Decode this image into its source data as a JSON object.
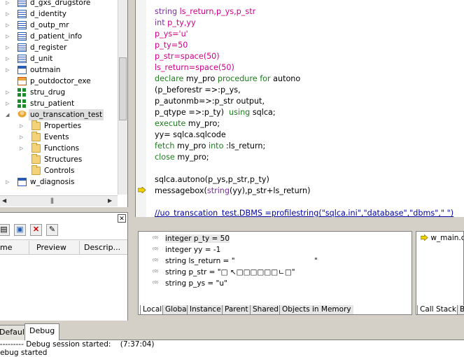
{
  "tree": {
    "items": [
      {
        "label": "d_gxs_drugstore",
        "icon": "datawindow-icon",
        "depth": 1,
        "expander": "closed"
      },
      {
        "label": "d_identity",
        "icon": "datawindow-icon",
        "depth": 1,
        "expander": "closed"
      },
      {
        "label": "d_outp_mr",
        "icon": "datawindow-icon",
        "depth": 1,
        "expander": "closed"
      },
      {
        "label": "d_patient_info",
        "icon": "datawindow-icon",
        "depth": 1,
        "expander": "closed"
      },
      {
        "label": "d_register",
        "icon": "datawindow-icon",
        "depth": 1,
        "expander": "closed"
      },
      {
        "label": "d_unit",
        "icon": "datawindow-icon",
        "depth": 1,
        "expander": "closed"
      },
      {
        "label": "outmain",
        "icon": "window-icon",
        "depth": 1,
        "expander": "closed"
      },
      {
        "label": "p_outdoctor_exe",
        "icon": "exe-icon",
        "depth": 1,
        "expander": "none"
      },
      {
        "label": "stru_drug",
        "icon": "structure-icon",
        "depth": 1,
        "expander": "closed"
      },
      {
        "label": "stru_patient",
        "icon": "structure-icon",
        "depth": 1,
        "expander": "closed"
      },
      {
        "label": "uo_transcation_test",
        "icon": "user-object-icon",
        "depth": 1,
        "expander": "open",
        "selected": true
      },
      {
        "label": "Properties",
        "icon": "folder-icon",
        "depth": 2,
        "expander": "closed"
      },
      {
        "label": "Events",
        "icon": "folder-icon",
        "depth": 2,
        "expander": "closed"
      },
      {
        "label": "Functions",
        "icon": "folder-icon",
        "depth": 2,
        "expander": "closed"
      },
      {
        "label": "Structures",
        "icon": "folder-icon",
        "depth": 2,
        "expander": "none"
      },
      {
        "label": "Controls",
        "icon": "folder-icon",
        "depth": 2,
        "expander": "none"
      },
      {
        "label": "w_diagnosis",
        "icon": "window-icon",
        "depth": 1,
        "expander": "closed"
      }
    ]
  },
  "lower_left": {
    "close_glyph": "✕",
    "columns": [
      "me",
      "Preview",
      "Descrip..."
    ]
  },
  "code": {
    "lines": [
      [
        {
          "t": "string",
          "c": "ty"
        },
        {
          "t": " ls_return,p_ys,p_str",
          "c": "nm"
        }
      ],
      [
        {
          "t": "int",
          "c": "ty"
        },
        {
          "t": " p_ty,yy",
          "c": "nm"
        }
      ],
      [
        {
          "t": "p_ys='u'",
          "c": "nm"
        }
      ],
      [
        {
          "t": "p_ty=50",
          "c": "nm"
        }
      ],
      [
        {
          "t": "p_str=space(50)",
          "c": "nm"
        }
      ],
      [
        {
          "t": "ls_return=space(50)",
          "c": "nm"
        }
      ],
      [
        {
          "t": "declare",
          "c": "kwg"
        },
        {
          "t": " my_pro ",
          "c": "pl"
        },
        {
          "t": "procedure for",
          "c": "kwg"
        },
        {
          "t": " autono",
          "c": "pl"
        }
      ],
      [
        {
          "t": "(p_beforestr =>:p_ys,",
          "c": "pl"
        }
      ],
      [
        {
          "t": "p_autonmb=>:p_str output,",
          "c": "pl"
        }
      ],
      [
        {
          "t": "p_qtype =>:p_ty)  ",
          "c": "pl"
        },
        {
          "t": "using",
          "c": "kwg"
        },
        {
          "t": " sqlca;",
          "c": "pl"
        }
      ],
      [
        {
          "t": "execute",
          "c": "kwg"
        },
        {
          "t": " my_pro;",
          "c": "pl"
        }
      ],
      [
        {
          "t": "yy= sqlca.sqlcode",
          "c": "pl"
        }
      ],
      [
        {
          "t": "fetch",
          "c": "kwg"
        },
        {
          "t": " my_pro ",
          "c": "pl"
        },
        {
          "t": "into",
          "c": "kwg"
        },
        {
          "t": " :ls_return;",
          "c": "pl"
        }
      ],
      [
        {
          "t": "close",
          "c": "kwg"
        },
        {
          "t": " my_pro;",
          "c": "pl"
        }
      ],
      [
        {
          "t": "",
          "c": "pl"
        }
      ],
      [
        {
          "t": "sqlca.autono(p_ys,p_str,p_ty)",
          "c": "pl"
        }
      ],
      [
        {
          "t": "messagebox(",
          "c": "pl"
        },
        {
          "t": "string",
          "c": "ty"
        },
        {
          "t": "(yy),p_str+ls_return)",
          "c": "pl"
        }
      ],
      [
        {
          "t": "",
          "c": "pl"
        }
      ],
      [
        {
          "t": "//uo_transcation_test.DBMS =profilestring(\"sqlca.ini\",\"database\",\"dbms\",\" \")",
          "c": "cm"
        }
      ]
    ]
  },
  "variables": {
    "rows": [
      {
        "text": "integer p_ty = 50",
        "selected": true
      },
      {
        "text": "integer yy = -1"
      },
      {
        "text": "string ls_return = \"                                  \""
      },
      {
        "text": "string p_str = \"□ ↖□□□□□□ㄴ□\""
      },
      {
        "text": "string p_ys = \"u\""
      }
    ],
    "tabs": [
      "Local",
      "Global",
      "Instance",
      "Parent",
      "Shared",
      "Objects in Memory"
    ]
  },
  "callstack": {
    "entry": "w_main.c",
    "tabs": [
      "Call Stack",
      "Br"
    ]
  },
  "output": {
    "tabs": [
      "Default",
      "Debug"
    ],
    "active_tab": "Debug",
    "lines": [
      "---------- Debug session started:    (7:37:04)",
      "Debug started"
    ]
  },
  "colors": {
    "keyword": "#1f7a1f",
    "type": "#7a2fa0",
    "variable": "#d0008a",
    "comment": "#0000a0",
    "breakpoint_arrow": "#f2d100"
  }
}
